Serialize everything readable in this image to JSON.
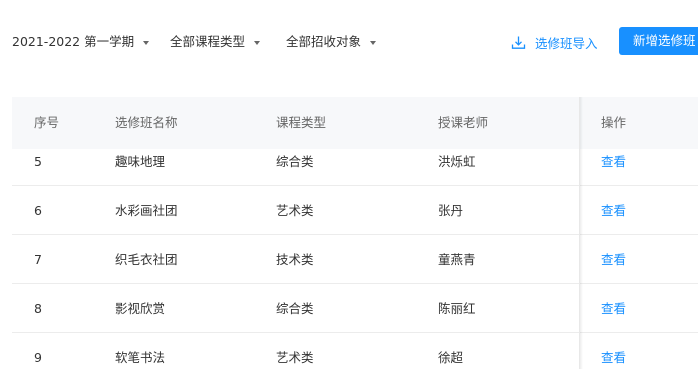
{
  "filters": {
    "term": "2021-2022 第一学期",
    "course_type": "全部课程类型",
    "target": "全部招收对象"
  },
  "actions": {
    "import_label": "选修班导入",
    "add_label": "新增选修班"
  },
  "table": {
    "headers": {
      "no": "序号",
      "name": "选修班名称",
      "type": "课程类型",
      "teacher": "授课老师",
      "op": "操作"
    },
    "rows": [
      {
        "no": "5",
        "name": "趣味地理",
        "type": "综合类",
        "teacher": "洪烁虹",
        "op": "查看"
      },
      {
        "no": "6",
        "name": "水彩画社团",
        "type": "艺术类",
        "teacher": "张丹",
        "op": "查看"
      },
      {
        "no": "7",
        "name": "织毛衣社团",
        "type": "技术类",
        "teacher": "童燕青",
        "op": "查看"
      },
      {
        "no": "8",
        "name": "影视欣赏",
        "type": "综合类",
        "teacher": "陈丽红",
        "op": "查看"
      },
      {
        "no": "9",
        "name": "软笔书法",
        "type": "艺术类",
        "teacher": "徐超",
        "op": "查看"
      }
    ]
  },
  "colors": {
    "accent": "#1890ff",
    "header_bg": "#f7f8fa"
  },
  "icons": {
    "caret": "caret-down-icon",
    "import": "download-icon"
  }
}
